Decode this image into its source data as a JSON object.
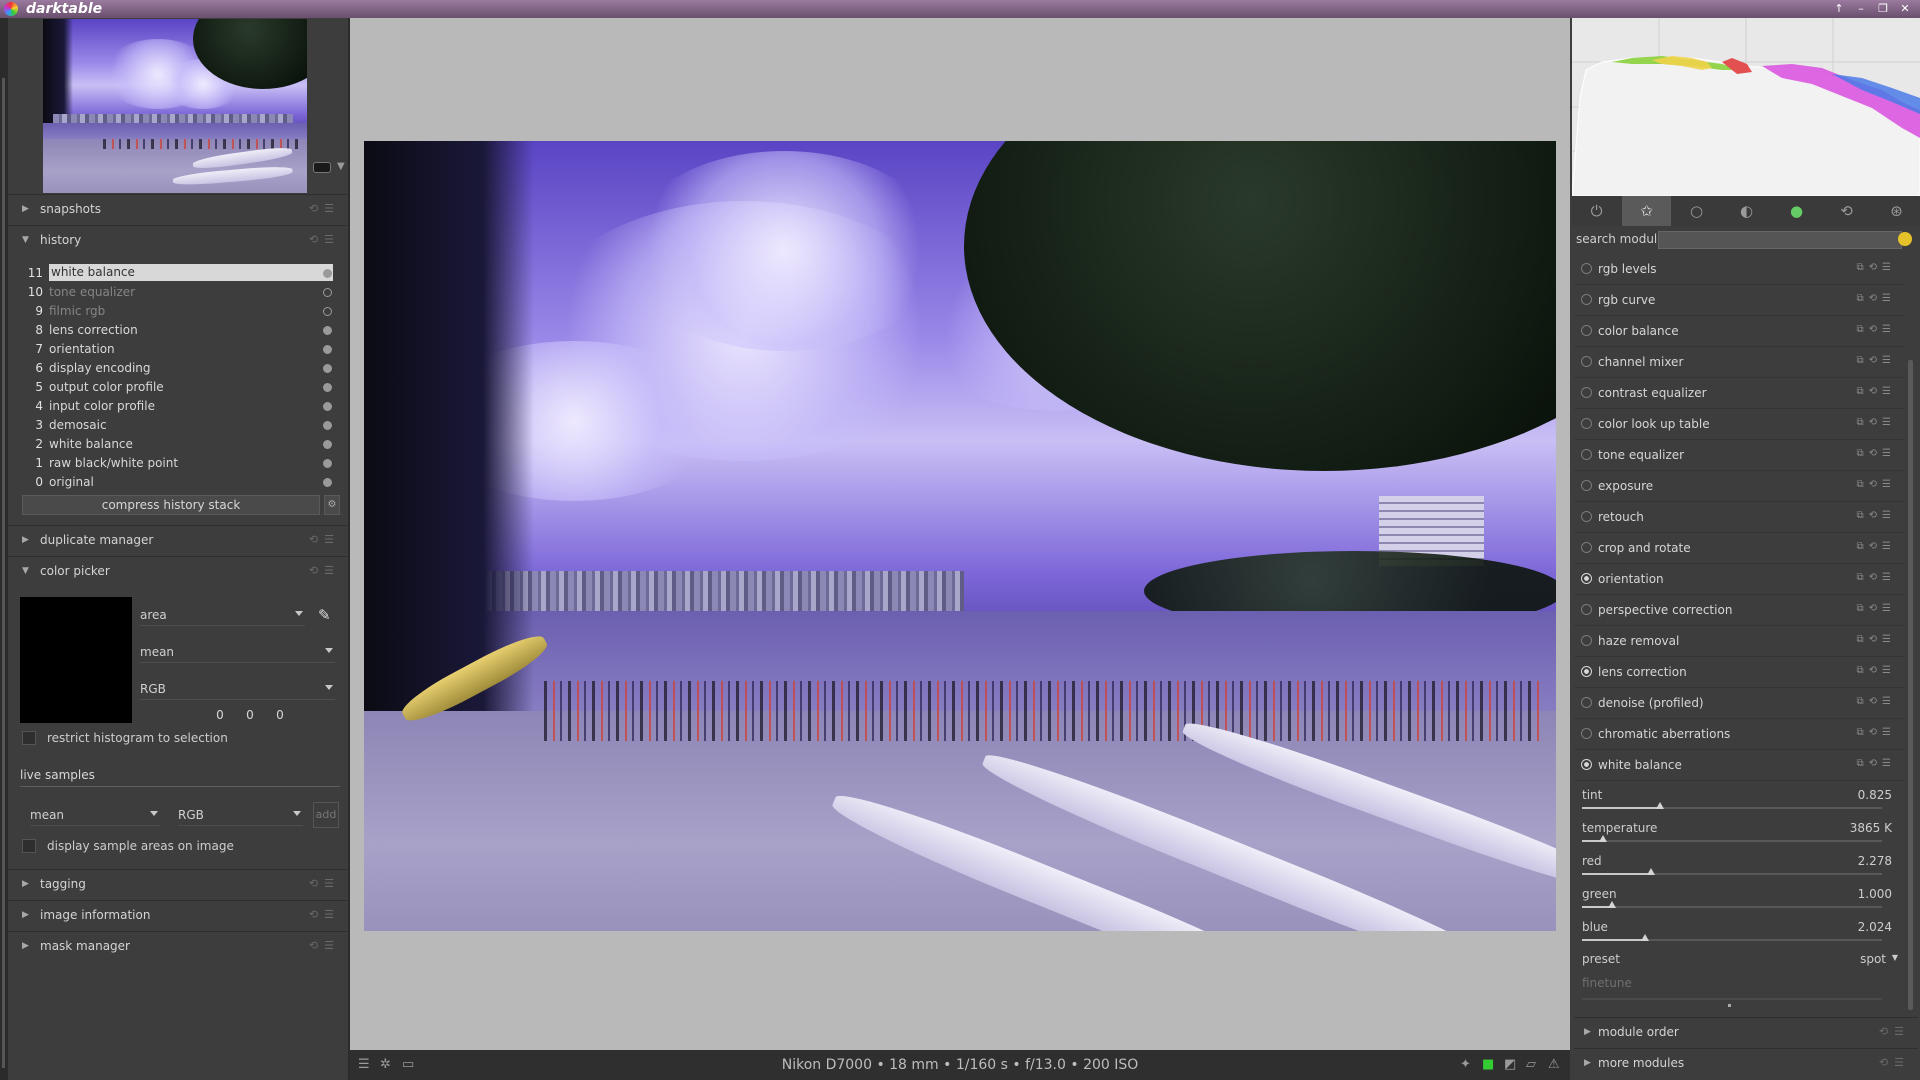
{
  "window": {
    "title": "darktable"
  },
  "left": {
    "sections": {
      "snapshots": "snapshots",
      "history": "history",
      "duplicate_manager": "duplicate manager",
      "color_picker": "color picker",
      "tagging": "tagging",
      "image_information": "image information",
      "mask_manager": "mask manager"
    },
    "history_items": [
      {
        "num": "11",
        "name": "white balance",
        "selected": true,
        "enabled": true
      },
      {
        "num": "10",
        "name": "tone equalizer",
        "enabled": false
      },
      {
        "num": "9",
        "name": "filmic rgb",
        "enabled": false
      },
      {
        "num": "8",
        "name": "lens correction",
        "enabled": true
      },
      {
        "num": "7",
        "name": "orientation",
        "enabled": true
      },
      {
        "num": "6",
        "name": "display encoding",
        "enabled": true
      },
      {
        "num": "5",
        "name": "output color profile",
        "enabled": true
      },
      {
        "num": "4",
        "name": "input color profile",
        "enabled": true
      },
      {
        "num": "3",
        "name": "demosaic",
        "enabled": true
      },
      {
        "num": "2",
        "name": "white balance",
        "enabled": true
      },
      {
        "num": "1",
        "name": "raw black/white point",
        "enabled": true
      },
      {
        "num": "0",
        "name": "original",
        "enabled": true
      }
    ],
    "compress_button": "compress history stack",
    "color_picker": {
      "mode": "area",
      "statistic": "mean",
      "color_space": "RGB",
      "values": [
        "0",
        "0",
        "0"
      ],
      "restrict_label": "restrict histogram to selection",
      "live_samples_label": "live samples",
      "live_statistic": "mean",
      "live_color_space": "RGB",
      "add_label": "add",
      "display_samples_label": "display sample areas on image"
    }
  },
  "bottom": {
    "info": "Nikon D7000  •  18 mm • 1/160 s • f/13.0 • 200 ISO"
  },
  "right": {
    "search_label": "search module",
    "search_value": "",
    "modules": [
      {
        "name": "rgb levels",
        "on": false
      },
      {
        "name": "rgb curve",
        "on": false
      },
      {
        "name": "color balance",
        "on": false
      },
      {
        "name": "channel mixer",
        "on": false
      },
      {
        "name": "contrast equalizer",
        "on": false
      },
      {
        "name": "color look up table",
        "on": false
      },
      {
        "name": "tone equalizer",
        "on": false
      },
      {
        "name": "exposure",
        "on": false
      },
      {
        "name": "retouch",
        "on": false
      },
      {
        "name": "crop and rotate",
        "on": false
      },
      {
        "name": "orientation",
        "on": true
      },
      {
        "name": "perspective correction",
        "on": false
      },
      {
        "name": "haze removal",
        "on": false
      },
      {
        "name": "lens correction",
        "on": true
      },
      {
        "name": "denoise (profiled)",
        "on": false
      },
      {
        "name": "chromatic aberrations",
        "on": false
      },
      {
        "name": "white balance",
        "on": true
      }
    ],
    "white_balance": {
      "params": [
        {
          "label": "tint",
          "value": "0.825",
          "fraction": 0.26
        },
        {
          "label": "temperature",
          "value": "3865 K",
          "fraction": 0.07
        },
        {
          "label": "red",
          "value": "2.278",
          "fraction": 0.23
        },
        {
          "label": "green",
          "value": "1.000",
          "fraction": 0.1
        },
        {
          "label": "blue",
          "value": "2.024",
          "fraction": 0.21
        }
      ],
      "preset_label": "preset",
      "preset_value": "spot",
      "finetune_label": "finetune"
    },
    "module_order": "module order",
    "more_modules": "more modules"
  }
}
